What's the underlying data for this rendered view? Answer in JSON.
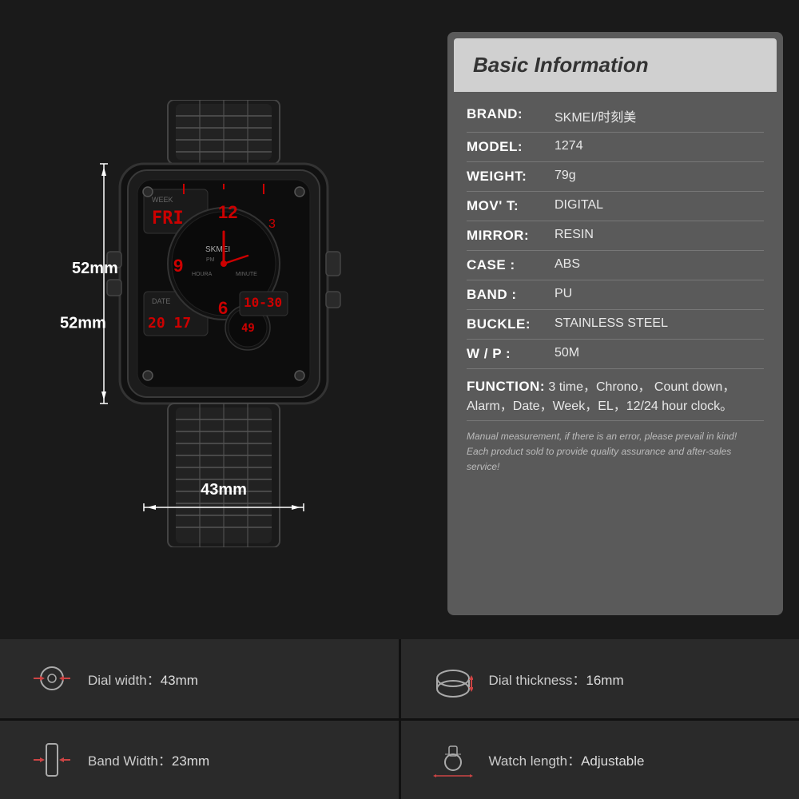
{
  "info": {
    "header": "Basic Information",
    "rows": [
      {
        "label": "BRAND:",
        "value": "SKMEI/时刻美"
      },
      {
        "label": "MODEL:",
        "value": "1274"
      },
      {
        "label": "WEIGHT:",
        "value": "79g"
      },
      {
        "label": "MOV' T:",
        "value": "DIGITAL"
      },
      {
        "label": "MIRROR:",
        "value": "RESIN"
      },
      {
        "label": "CASE :",
        "value": "ABS"
      },
      {
        "label": "BAND :",
        "value": "PU"
      },
      {
        "label": "BUCKLE:",
        "value": "STAINLESS STEEL"
      },
      {
        "label": "W / P :",
        "value": "50M"
      }
    ],
    "function_label": "FUNCTION:",
    "function_value": " 3 time，Chrono， Count down，Alarm，Date，Week，EL，12/24 hour clock。",
    "note_line1": "Manual measurement, if there is an error, please prevail in kind!",
    "note_line2": "Each product sold to provide quality assurance and after-sales service!"
  },
  "dimensions": {
    "height": "52mm",
    "width": "43mm"
  },
  "specs": [
    {
      "key": "Dial width：",
      "value": "43mm",
      "icon": "dial-width-icon"
    },
    {
      "key": "Dial thickness：",
      "value": "16mm",
      "icon": "dial-thickness-icon"
    },
    {
      "key": "Band Width：",
      "value": "23mm",
      "icon": "band-width-icon"
    },
    {
      "key": "Watch length：",
      "value": "Adjustable",
      "icon": "watch-length-icon"
    }
  ]
}
